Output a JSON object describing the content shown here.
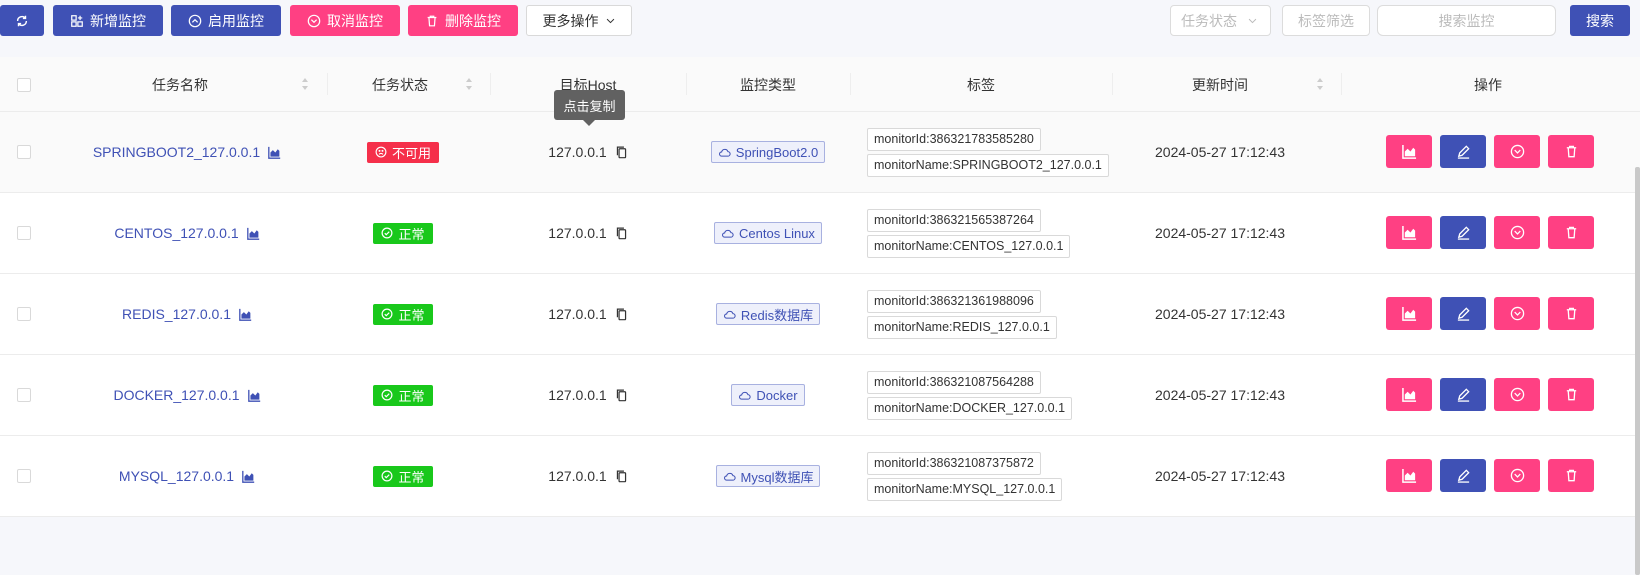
{
  "toolbar": {
    "refresh_icon": "refresh-icon",
    "add_label": "新增监控",
    "enable_label": "启用监控",
    "cancel_label": "取消监控",
    "delete_label": "删除监控",
    "more_label": "更多操作",
    "status_filter_placeholder": "任务状态",
    "tag_filter_placeholder": "标签筛选",
    "search_placeholder": "搜索监控",
    "search_label": "搜索"
  },
  "columns": {
    "name": "任务名称",
    "status": "任务状态",
    "host": "目标Host",
    "type": "监控类型",
    "tags": "标签",
    "updated": "更新时间",
    "actions": "操作"
  },
  "tooltip": "点击复制",
  "rows": [
    {
      "name": "SPRINGBOOT2_127.0.0.1",
      "status": "不可用",
      "status_kind": "bad",
      "host": "127.0.0.1",
      "type": "SpringBoot2.0",
      "tag_id": "monitorId:386321783585280",
      "tag_name": "monitorName:SPRINGBOOT2_127.0.0.1",
      "updated": "2024-05-27 17:12:43"
    },
    {
      "name": "CENTOS_127.0.0.1",
      "status": "正常",
      "status_kind": "ok",
      "host": "127.0.0.1",
      "type": "Centos Linux",
      "tag_id": "monitorId:386321565387264",
      "tag_name": "monitorName:CENTOS_127.0.0.1",
      "updated": "2024-05-27 17:12:43"
    },
    {
      "name": "REDIS_127.0.0.1",
      "status": "正常",
      "status_kind": "ok",
      "host": "127.0.0.1",
      "type": "Redis数据库",
      "tag_id": "monitorId:386321361988096",
      "tag_name": "monitorName:REDIS_127.0.0.1",
      "updated": "2024-05-27 17:12:43"
    },
    {
      "name": "DOCKER_127.0.0.1",
      "status": "正常",
      "status_kind": "ok",
      "host": "127.0.0.1",
      "type": "Docker",
      "tag_id": "monitorId:386321087564288",
      "tag_name": "monitorName:DOCKER_127.0.0.1",
      "updated": "2024-05-27 17:12:43"
    },
    {
      "name": "MYSQL_127.0.0.1",
      "status": "正常",
      "status_kind": "ok",
      "host": "127.0.0.1",
      "type": "Mysql数据库",
      "tag_id": "monitorId:386321087375872",
      "tag_name": "monitorName:MYSQL_127.0.0.1",
      "updated": "2024-05-27 17:12:43"
    }
  ],
  "colors": {
    "primary": "#3f51b5",
    "pink": "#ff4083",
    "ok": "#19c81b",
    "bad": "#f52f4a"
  }
}
